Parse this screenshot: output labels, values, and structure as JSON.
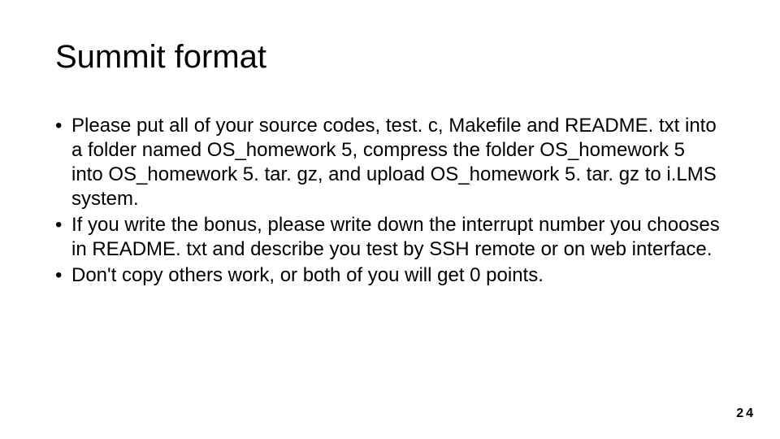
{
  "slide": {
    "title": "Summit format",
    "bullets": [
      "Please put all of your source codes, test. c, Makefile and README. txt into a folder named OS_homework 5, compress the folder OS_homework 5 into  OS_homework 5. tar. gz, and upload OS_homework 5. tar. gz to i.LMS system.",
      "If you write the bonus, please write down the interrupt number you chooses in README. txt and describe you test by SSH remote or on web interface.",
      "Don't copy others work, or both of you will get 0 points."
    ],
    "page_number": "24"
  }
}
